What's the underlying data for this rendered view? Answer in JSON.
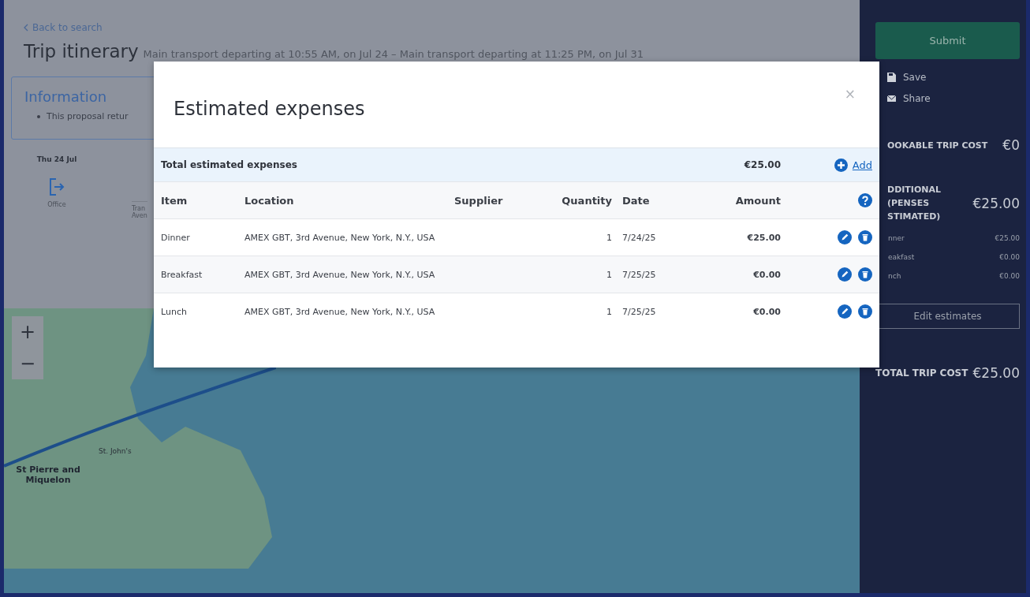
{
  "back_link": "Back to search",
  "page_title": "Trip itinerary",
  "page_subtitle": "Main transport departing at 10:55 AM, on Jul 24 – Main transport departing at 11:25 PM, on Jul 31",
  "information": {
    "title": "Information",
    "items": [
      "This proposal retur"
    ]
  },
  "timeline": {
    "date": "Thu 24 Jul",
    "office_label": "Office",
    "segment_lines": [
      "Tran",
      "Aven"
    ]
  },
  "map": {
    "zoom_in": "+",
    "zoom_out": "−",
    "labels": [
      {
        "kind": "city",
        "text": "St. John's"
      },
      {
        "kind": "region",
        "text": "St Pierre and Miquelon"
      }
    ]
  },
  "sidebar": {
    "submit": "Submit",
    "actions": [
      {
        "kind": "save",
        "label": "Save"
      },
      {
        "kind": "share",
        "label": "Share"
      }
    ],
    "bookable": {
      "label": "OOKABLE TRIP COST",
      "value": "€0"
    },
    "additional": {
      "label_lines": [
        "DDITIONAL",
        "(PENSES",
        "STIMATED)"
      ],
      "value": "€25.00",
      "items": [
        {
          "name": "nner",
          "amount": "€25.00"
        },
        {
          "name": "eakfast",
          "amount": "€0.00"
        },
        {
          "name": "nch",
          "amount": "€0.00"
        }
      ]
    },
    "edit_button": "Edit estimates",
    "total": {
      "label": "TOTAL TRIP COST",
      "value": "€25.00"
    }
  },
  "modal": {
    "title": "Estimated expenses",
    "close": "×",
    "total": {
      "label": "Total estimated expenses",
      "amount": "€25.00",
      "add_label": "Add"
    },
    "columns": [
      "Item",
      "Location",
      "Supplier",
      "Quantity",
      "Date",
      "Amount"
    ],
    "rows": [
      {
        "item": "Dinner",
        "location": "AMEX GBT, 3rd Avenue, New York, N.Y., USA",
        "quantity": "1",
        "date": "7/24/25",
        "amount": "€25.00"
      },
      {
        "item": "Breakfast",
        "location": "AMEX GBT, 3rd Avenue, New York, N.Y., USA",
        "quantity": "1",
        "date": "7/25/25",
        "amount": "€0.00"
      },
      {
        "item": "Lunch",
        "location": "AMEX GBT, 3rd Avenue, New York, N.Y., USA",
        "quantity": "1",
        "date": "7/25/25",
        "amount": "€0.00"
      }
    ]
  }
}
